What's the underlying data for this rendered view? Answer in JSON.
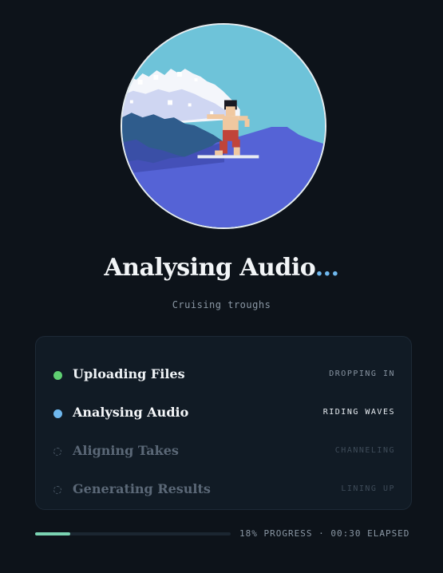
{
  "header": {
    "title": "Analysing Audio",
    "title_dots": "...",
    "subtitle": "Cruising troughs"
  },
  "steps": [
    {
      "label": "Uploading Files",
      "status": "DROPPING IN",
      "state": "done",
      "dot_color": "#5fcf72",
      "label_color": "#eef2f5",
      "status_color": "#8793a0"
    },
    {
      "label": "Analysing Audio",
      "status": "RIDING WAVES",
      "state": "active",
      "dot_color": "#6fb8ee",
      "label_color": "#f6f8fa",
      "status_color": "#e8edf2"
    },
    {
      "label": "Aligning Takes",
      "status": "CHANNELING",
      "state": "pending",
      "dot_color": "#4a5866",
      "label_color": "#5b6877",
      "status_color": "#3e4b58"
    },
    {
      "label": "Generating Results",
      "status": "LINING UP",
      "state": "pending",
      "dot_color": "#4a5866",
      "label_color": "#5b6877",
      "status_color": "#3e4b58"
    }
  ],
  "progress": {
    "percent": 18,
    "text": "18% PROGRESS · 00:30 ELAPSED"
  },
  "colors": {
    "background": "#0d131a",
    "accent": "#6fb8ee",
    "progress_fill": "#7ad3b2"
  },
  "illustration": {
    "icon": "pixel-surfer-illustration"
  }
}
